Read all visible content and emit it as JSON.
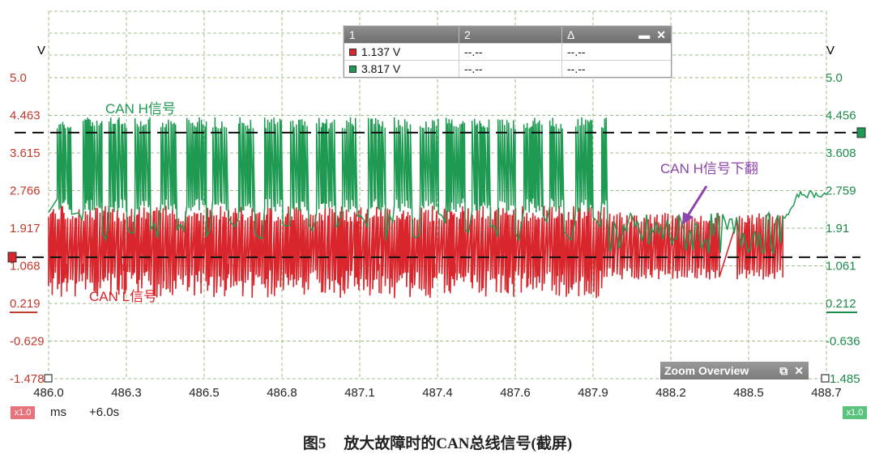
{
  "colors": {
    "channel_l": "#d8262c",
    "channel_h": "#1e9a52",
    "grid": "#9bbd85",
    "axis_left": "#c0392b",
    "axis_right": "#1e8a4a"
  },
  "measurement_panel": {
    "headers": [
      "1",
      "2",
      "Δ"
    ],
    "rows": [
      {
        "channel_color": "#d8262c",
        "values": [
          "1.137 V",
          "--.--",
          "--.--"
        ]
      },
      {
        "channel_color": "#1e9a52",
        "values": [
          "3.817 V",
          "--.--",
          "--.--"
        ]
      }
    ],
    "pin_icon": "pin-icon",
    "close_icon": "close-icon"
  },
  "zoom_overview": {
    "label": "Zoom Overview",
    "restore_icon": "restore-icon",
    "close_icon": "close-icon"
  },
  "chart_data": {
    "type": "line",
    "xlabel": "ms",
    "xlim": [
      486.0,
      488.7
    ],
    "x_ticks": [
      "486.0",
      "486.3",
      "486.5",
      "486.8",
      "487.1",
      "487.4",
      "487.6",
      "487.9",
      "488.2",
      "488.5",
      "488.7"
    ],
    "left_axis": {
      "unit": "V",
      "ylim": [
        -1.478,
        5.0
      ],
      "ticks": [
        "5.0",
        "4.463",
        "3.615",
        "2.766",
        "1.917",
        "1.068",
        "0.219",
        "-0.629",
        "-1.478"
      ]
    },
    "right_axis": {
      "unit": "V",
      "ylim": [
        -1.485,
        5.0
      ],
      "ticks": [
        "5.0",
        "4.456",
        "3.608",
        "2.759",
        "1.91",
        "1.061",
        "0.212",
        "-0.636",
        "-1.485"
      ]
    },
    "cursor_lines": [
      {
        "value": 3.817,
        "channel": "CAN H"
      },
      {
        "value": 1.137,
        "channel": "CAN L"
      }
    ],
    "annotations": [
      "CAN H信号",
      "CAN L信号",
      "CAN H信号下翻"
    ],
    "series": [
      {
        "name": "CAN H信号",
        "color": "#1e9a52",
        "segments": [
          {
            "x_start": 486.0,
            "x_end": 487.94,
            "recessive_v": 2.3,
            "dominant_v": 3.9,
            "state": "toggling"
          },
          {
            "x_start": 487.94,
            "x_end": 488.55,
            "recessive_v": 1.9,
            "dominant_v": 1.2,
            "state": "flipped down"
          },
          {
            "x_start": 488.55,
            "x_end": 488.7,
            "recessive_v": 2.3,
            "dominant_v": 2.3,
            "state": "idle"
          }
        ]
      },
      {
        "name": "CAN L信号",
        "color": "#d8262c",
        "segments": [
          {
            "x_start": 486.0,
            "x_end": 487.94,
            "recessive_v": 2.0,
            "dominant_v": 1.1,
            "state": "toggling"
          },
          {
            "x_start": 487.94,
            "x_end": 488.55,
            "recessive_v": 1.9,
            "dominant_v": 1.0,
            "state": "toggling"
          }
        ]
      }
    ]
  },
  "bottom_bar": {
    "left_zoom": "x1.0",
    "unit": "ms",
    "offset": "+6.0s",
    "right_zoom": "x1.0"
  },
  "caption": {
    "figure": "图5",
    "text": "放大故障时的CAN总线信号(截屏)"
  }
}
